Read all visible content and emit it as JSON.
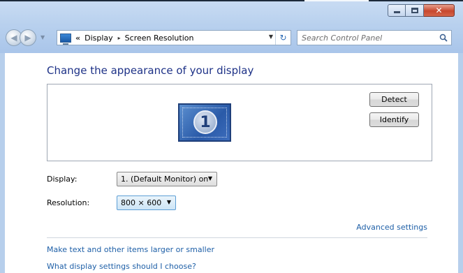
{
  "window": {
    "caption_buttons": {
      "minimize_icon": "minimize-icon",
      "maximize_icon": "maximize-icon",
      "close_icon": "close-icon"
    }
  },
  "nav": {
    "back_icon": "back-arrow-icon",
    "forward_icon": "forward-arrow-icon"
  },
  "address": {
    "overflow_chevron": "«",
    "crumbs": [
      "Display",
      "Screen Resolution"
    ],
    "separator": "▸",
    "icon": "display-control-panel-icon"
  },
  "search": {
    "placeholder": "Search Control Panel",
    "icon": "search-icon"
  },
  "main": {
    "title": "Change the appearance of your display",
    "monitor_number": "1",
    "detect_label": "Detect",
    "identify_label": "Identify",
    "display_label": "Display:",
    "display_value": "1. (Default Monitor) on",
    "resolution_label": "Resolution:",
    "resolution_value": "800 × 600",
    "advanced_link": "Advanced settings",
    "link_larger": "Make text and other items larger or smaller",
    "link_choose": "What display settings should I choose?"
  },
  "colors": {
    "title": "#1e3287",
    "link": "#1e5fa7",
    "frame": "#b9d1ee",
    "close_button": "#c7472d"
  }
}
